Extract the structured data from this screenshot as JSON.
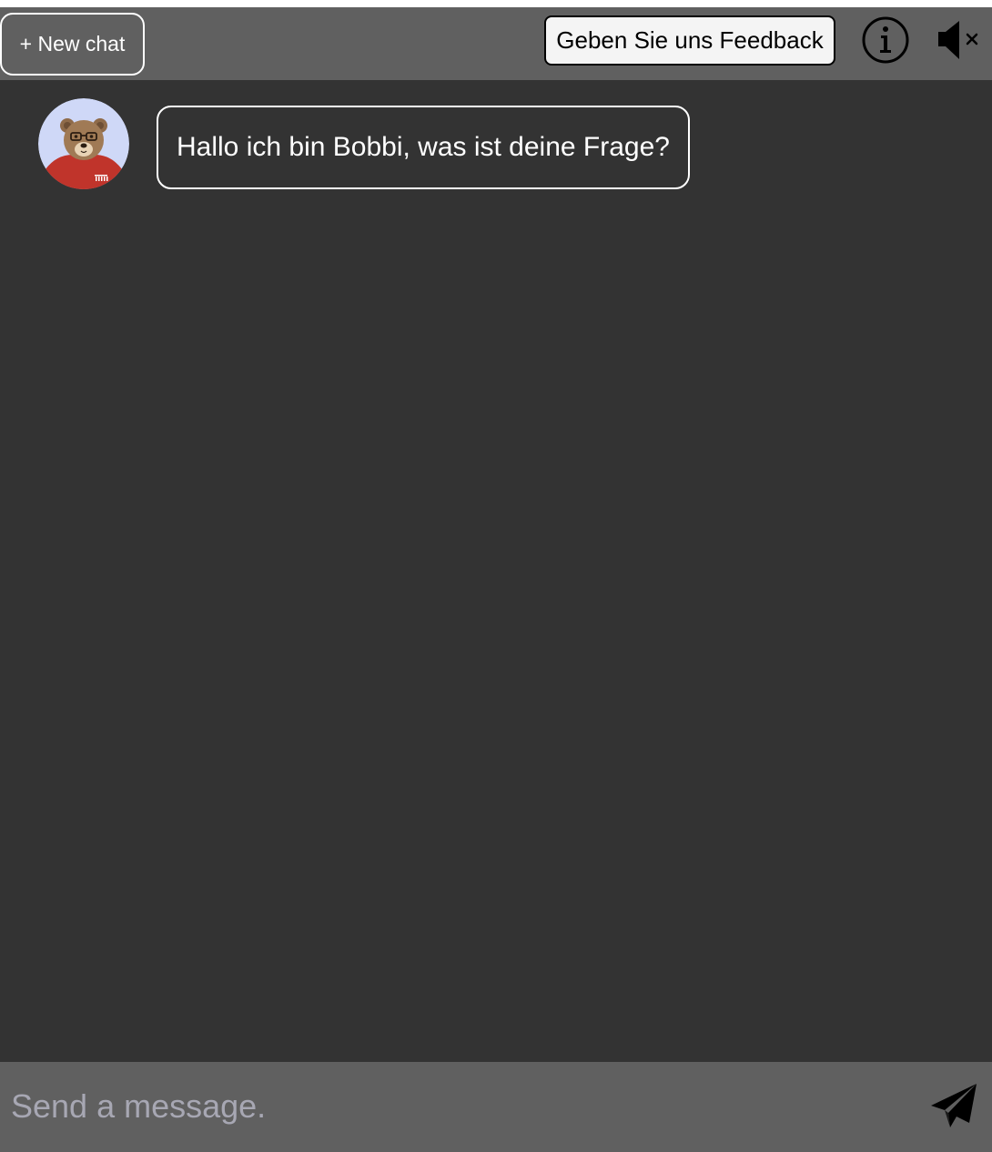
{
  "header": {
    "new_chat_label": "+ New chat",
    "feedback_label": "Geben Sie uns Feedback",
    "info_icon": "info-icon",
    "mute_icon": "speaker-muted-icon"
  },
  "chat": {
    "messages": [
      {
        "sender": "bot",
        "avatar": "bear-avatar",
        "text": "Hallo ich bin Bobbi, was ist deine Frage?"
      }
    ]
  },
  "composer": {
    "placeholder": "Send a message.",
    "value": "",
    "send_icon": "paper-plane-icon"
  },
  "colors": {
    "background": "#333333",
    "bar": "#606060",
    "text": "#ffffff",
    "placeholder": "#a7a7b3",
    "feedback_bg": "#f4f4f4"
  }
}
